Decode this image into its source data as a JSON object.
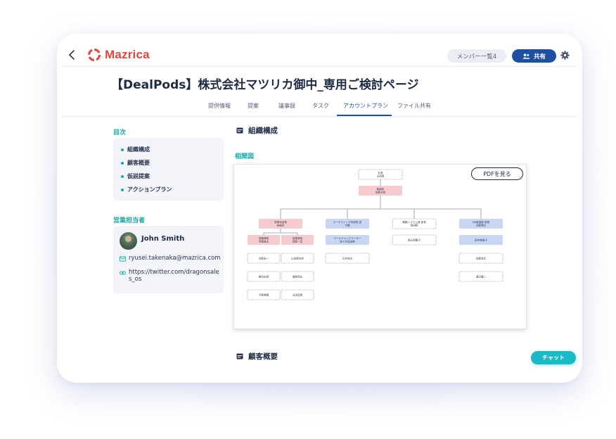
{
  "app": {
    "brand": "Mazrica",
    "brand_color": "#e0483c",
    "accent": "#1e4fa3",
    "teal": "#1aa7a4"
  },
  "header": {
    "members_label": "メンバー一覧4",
    "share_label": "共有"
  },
  "page_title": "【DealPods】株式会社マツリカ御中_専用ご検討ページ",
  "tabs": [
    {
      "label": "提供情報"
    },
    {
      "label": "提案"
    },
    {
      "label": "議事録"
    },
    {
      "label": "タスク"
    },
    {
      "label": "アカウントプラン",
      "active": true
    },
    {
      "label": "ファイル共有"
    }
  ],
  "toc": {
    "title": "目次",
    "items": [
      "組織構成",
      "顧客概要",
      "仮説提案",
      "アクションプラン"
    ]
  },
  "representative": {
    "title": "営業担当者",
    "name": "John Smith",
    "email": "ryusei.takenaka@mazrica.com",
    "link": "https://twitter.com/dragonsales_os"
  },
  "sections": {
    "org": "組織構成",
    "diagram_label": "相関図",
    "pdf_button": "PDFを見る",
    "customer": "顧客概要"
  },
  "org_chart": {
    "nodes": [
      {
        "id": "president",
        "lines": [
          "社長",
          "山田尊"
        ],
        "style": "dashed",
        "col": "top",
        "row": 0
      },
      {
        "id": "director",
        "lines": [
          "取締役",
          "佐藤太郎"
        ],
        "style": "pink",
        "col": "top",
        "row": 1
      },
      {
        "id": "sales_head",
        "lines": [
          "営業本部長",
          "後藤武"
        ],
        "style": "pink",
        "col": "c1",
        "row": 2
      },
      {
        "id": "marketing_head",
        "lines": [
          "マーケティング本部長 田",
          "中譲"
        ],
        "style": "blue",
        "col": "c2",
        "row": 2
      },
      {
        "id": "it_head",
        "lines": [
          "情報システム部 部長",
          "西田翔"
        ],
        "style": "dashed",
        "col": "c3",
        "row": 2
      },
      {
        "id": "dx_head",
        "lines": [
          "DX推進部 部長",
          "近藤健太"
        ],
        "style": "blue",
        "col": "c4",
        "row": 2
      },
      {
        "id": "sales_mgr1",
        "lines": [
          "営業課長",
          "伊藤雄太"
        ],
        "style": "pink",
        "col": "c1a",
        "row": 3
      },
      {
        "id": "sales_mgr2",
        "lines": [
          "営業課長",
          "斉藤一真"
        ],
        "style": "pink",
        "col": "c1b",
        "row": 3
      },
      {
        "id": "mkt_leader",
        "lines": [
          "マーケティングリーダー",
          "佐々木真由美"
        ],
        "style": "blue",
        "col": "c2",
        "row": 3
      },
      {
        "id": "it_member",
        "lines": [
          "森山和樹子"
        ],
        "style": "dashed",
        "col": "c3",
        "row": 3
      },
      {
        "id": "dx_member1",
        "lines": [
          "田中美香子"
        ],
        "style": "blue",
        "col": "c4",
        "row": 3
      },
      {
        "id": "s1",
        "lines": [
          "近藤友一"
        ],
        "style": "dashed",
        "col": "c1a",
        "row": 4
      },
      {
        "id": "s2",
        "lines": [
          "山田健太郎"
        ],
        "style": "dashed",
        "col": "c1b",
        "row": 4
      },
      {
        "id": "m2",
        "lines": [
          "石井悠太"
        ],
        "style": "dashed",
        "col": "c2",
        "row": 4
      },
      {
        "id": "d2",
        "lines": [
          "佐藤悠太"
        ],
        "style": "dashed",
        "col": "c4",
        "row": 4
      },
      {
        "id": "s3",
        "lines": [
          "飯田志保"
        ],
        "style": "dashed",
        "col": "c1a",
        "row": 5
      },
      {
        "id": "s4",
        "lines": [
          "福島和弘"
        ],
        "style": "dashed",
        "col": "c1b",
        "row": 5
      },
      {
        "id": "d3",
        "lines": [
          "渡辺隆二"
        ],
        "style": "dashed",
        "col": "c4",
        "row": 5
      },
      {
        "id": "s5",
        "lines": [
          "平野美穂"
        ],
        "style": "dashed",
        "col": "c1a",
        "row": 6
      },
      {
        "id": "s6",
        "lines": [
          "太田真希"
        ],
        "style": "dashed",
        "col": "c1b",
        "row": 6
      }
    ],
    "colors": {
      "pink": "#f6cbcf",
      "blue": "#c9d6f3"
    }
  },
  "chat_label": "チャット"
}
